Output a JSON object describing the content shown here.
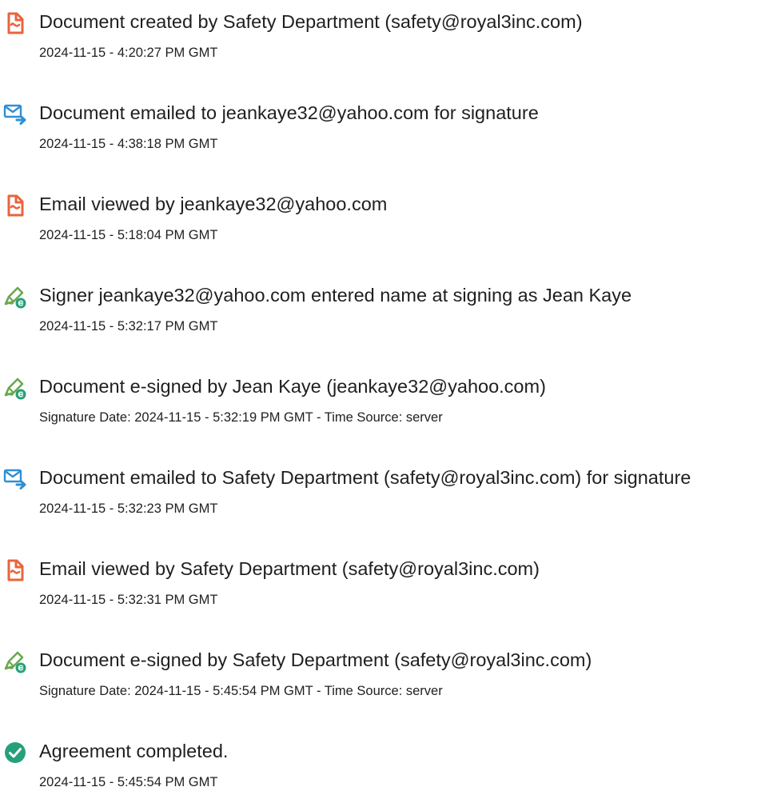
{
  "events": [
    {
      "icon": "document-icon",
      "title": "Document created by Safety Department (safety@royal3inc.com)",
      "time": "2024-11-15 - 4:20:27 PM GMT"
    },
    {
      "icon": "email-send-icon",
      "title": "Document emailed to jeankaye32@yahoo.com for signature",
      "time": "2024-11-15 - 4:38:18 PM GMT"
    },
    {
      "icon": "document-icon",
      "title": "Email viewed by jeankaye32@yahoo.com",
      "time": "2024-11-15 - 5:18:04 PM GMT"
    },
    {
      "icon": "signature-pen-icon",
      "title": "Signer jeankaye32@yahoo.com entered name at signing as Jean Kaye",
      "time": "2024-11-15 - 5:32:17 PM GMT"
    },
    {
      "icon": "signature-pen-icon",
      "title": "Document e-signed by Jean Kaye (jeankaye32@yahoo.com)",
      "time": "Signature Date: 2024-11-15 - 5:32:19 PM GMT - Time Source: server"
    },
    {
      "icon": "email-send-icon",
      "title": "Document emailed to Safety Department (safety@royal3inc.com) for signature",
      "time": "2024-11-15 - 5:32:23 PM GMT"
    },
    {
      "icon": "document-icon",
      "title": "Email viewed by Safety Department (safety@royal3inc.com)",
      "time": "2024-11-15 - 5:32:31 PM GMT"
    },
    {
      "icon": "signature-pen-icon",
      "title": "Document e-signed by Safety Department (safety@royal3inc.com)",
      "time": "Signature Date: 2024-11-15 - 5:45:54 PM GMT - Time Source: server"
    },
    {
      "icon": "check-circle-icon",
      "title": "Agreement completed.",
      "time": "2024-11-15 - 5:45:54 PM GMT"
    }
  ],
  "colors": {
    "document_icon": "#e8643d",
    "email_icon": "#2f8fd4",
    "pen_icon": "#6aa84f",
    "badge": "#26a07a",
    "check": "#26a07a",
    "text": "#1f1f1f"
  }
}
